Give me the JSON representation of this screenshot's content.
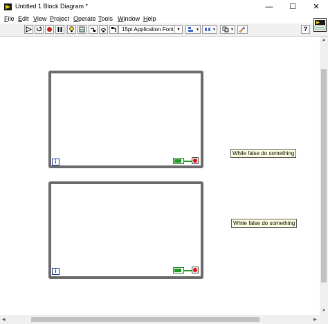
{
  "window": {
    "title": "Untitled 1 Block Diagram *",
    "controls": {
      "minimize": "—",
      "maximize": "☐",
      "close": "✕"
    }
  },
  "menu": [
    {
      "label": "File",
      "mnemonic": "F",
      "rest": "ile"
    },
    {
      "label": "Edit",
      "mnemonic": "E",
      "rest": "dit"
    },
    {
      "label": "View",
      "mnemonic": "V",
      "rest": "iew"
    },
    {
      "label": "Project",
      "mnemonic": "P",
      "rest": "roject"
    },
    {
      "label": "Operate",
      "mnemonic": "O",
      "rest": "perate"
    },
    {
      "label": "Tools",
      "mnemonic": "T",
      "rest": "ools"
    },
    {
      "label": "Window",
      "mnemonic": "W",
      "rest": "indow"
    },
    {
      "label": "Help",
      "mnemonic": "H",
      "rest": "elp"
    }
  ],
  "toolbar": {
    "font_select": "15pt Application Font",
    "help_label": "?",
    "icons": [
      "run-arrow-icon",
      "run-continuously-icon",
      "abort-icon",
      "pause-icon",
      "highlight-execution-icon",
      "retain-wire-values-icon",
      "step-into-icon",
      "step-over-icon",
      "step-out-icon",
      "align-objects-icon",
      "distribute-objects-icon",
      "reorder-icon",
      "clean-up-diagram-icon",
      "context-help-icon"
    ]
  },
  "diagram": {
    "loops": [
      {
        "iteration_label": "i",
        "comment": "While false do something"
      },
      {
        "iteration_label": "i",
        "comment": "While false do something"
      }
    ]
  },
  "colors": {
    "loop_border": "#6b6b6b",
    "iteration_terminal": "#1e3a9c",
    "boolean_wire": "#1f9a1f",
    "stop_terminal": "#e01010",
    "comment_background": "#ffffe1"
  }
}
